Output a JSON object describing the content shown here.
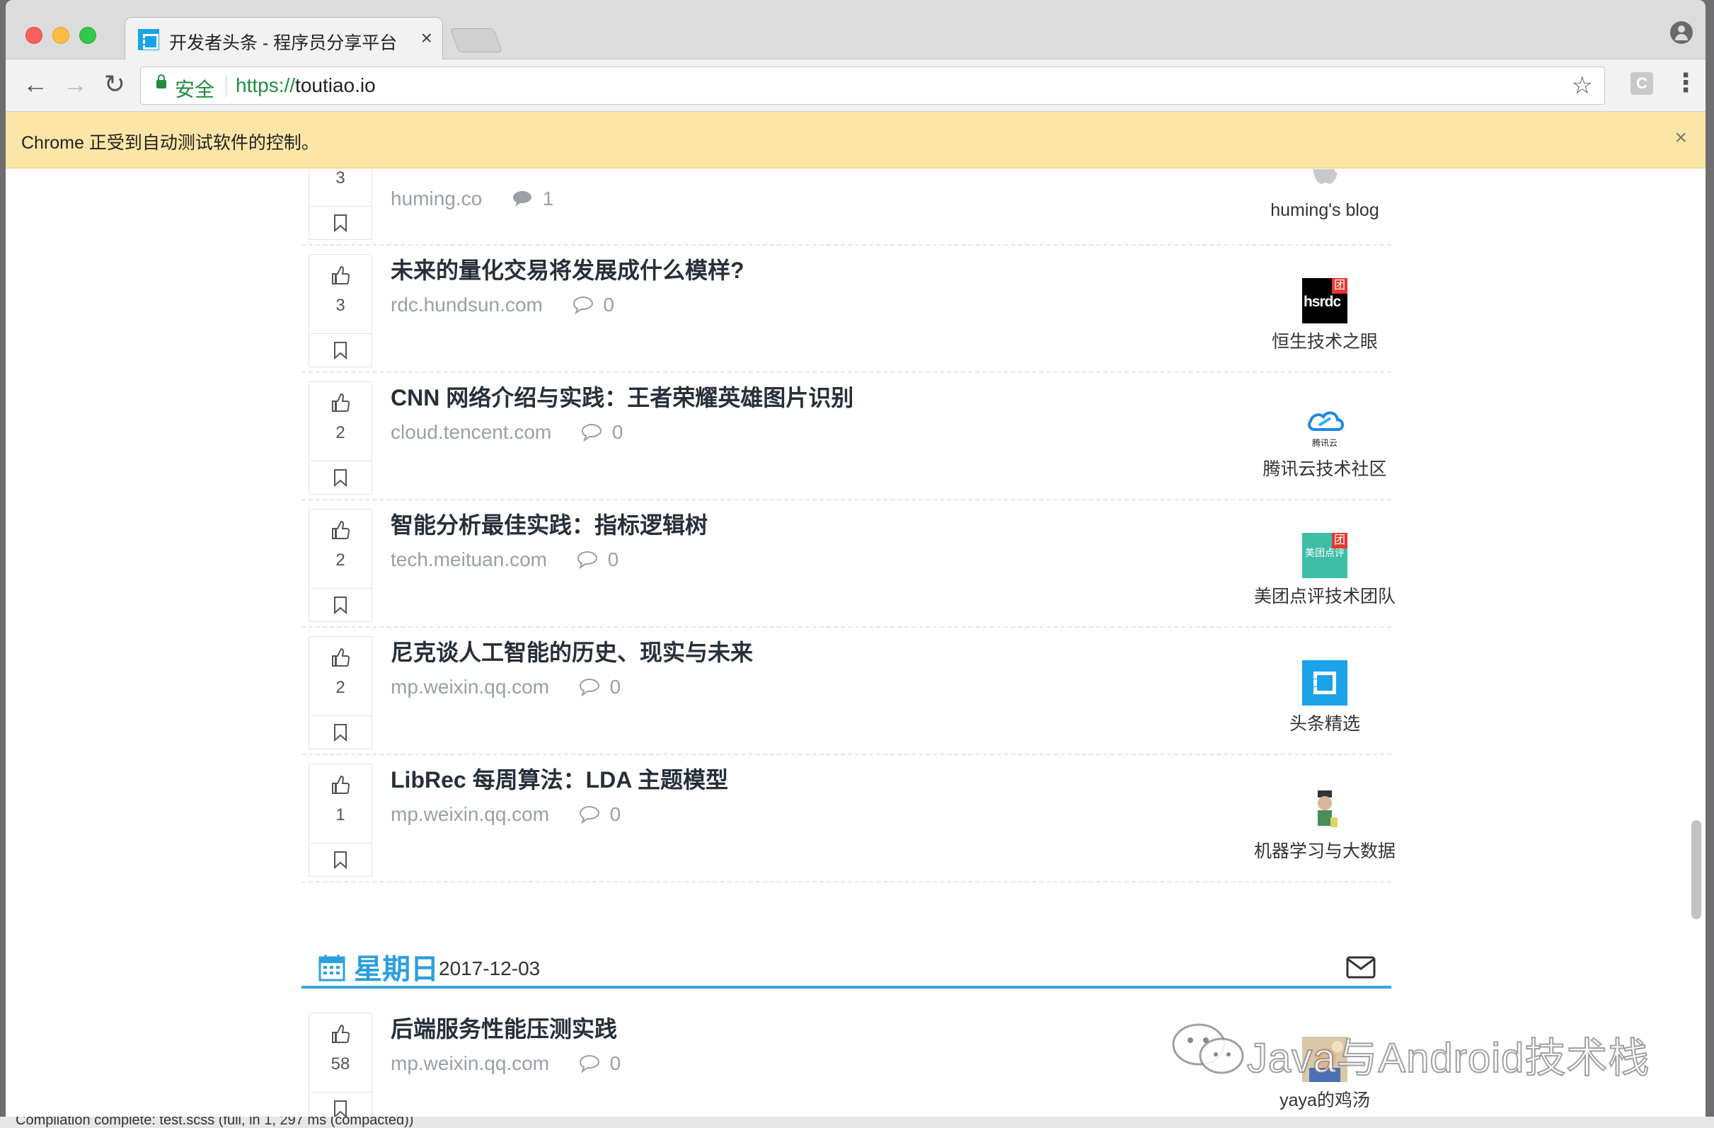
{
  "browser": {
    "tab_title": "开发者头条 - 程序员分享平台 | 开",
    "tab_close": "×",
    "secure_label": "安全",
    "url_scheme": "https://",
    "url_host": "toutiao.io",
    "ext_letter": "C",
    "infobar_text": "Chrome 正受到自动测试软件的控制。",
    "infobar_close": "×"
  },
  "articles": [
    {
      "title": "",
      "domain": "huming.co",
      "comments": "1",
      "votes": "3",
      "source": "huming's blog",
      "logo_icon": "apple-icon"
    },
    {
      "title": "未来的量化交易将发展成什么模样?",
      "domain": "rdc.hundsun.com",
      "comments": "0",
      "votes": "3",
      "source": "恒生技术之眼",
      "logo_icon": "hsrdc-logo"
    },
    {
      "title": "CNN 网络介绍与实践：王者荣耀英雄图片识别",
      "domain": "cloud.tencent.com",
      "comments": "0",
      "votes": "2",
      "source": "腾讯云技术社区",
      "logo_icon": "tencent-cloud-logo"
    },
    {
      "title": "智能分析最佳实践：指标逻辑树",
      "domain": "tech.meituan.com",
      "comments": "0",
      "votes": "2",
      "source": "美团点评技术团队",
      "logo_icon": "meituan-logo"
    },
    {
      "title": "尼克谈人工智能的历史、现实与未来",
      "domain": "mp.weixin.qq.com",
      "comments": "0",
      "votes": "2",
      "source": "头条精选",
      "logo_icon": "toutiao-logo"
    },
    {
      "title": "LibRec 每周算法：LDA 主题模型",
      "domain": "mp.weixin.qq.com",
      "comments": "0",
      "votes": "1",
      "source": "机器学习与大数据",
      "logo_icon": "ml-avatar"
    },
    {
      "title": "后端服务性能压测实践",
      "domain": "mp.weixin.qq.com",
      "comments": "0",
      "votes": "58",
      "source": "yaya的鸡汤",
      "logo_icon": "yaya-avatar"
    }
  ],
  "day_header": {
    "name": "星期日",
    "date": "2017-12-03"
  },
  "hsrdc_text": "hsrdc",
  "tuan_text": "团",
  "tencent_small": "腾讯云",
  "meituan_small": "美团点评",
  "watermark": "Java与Android技术栈",
  "statusbar": "Compilation complete: test.scss (full, in 1, 297 ms (compacted))",
  "colors": {
    "accent": "#2c9fdf",
    "secure_green": "#1e8e3e",
    "infobar_bg": "#fbe6a7"
  }
}
